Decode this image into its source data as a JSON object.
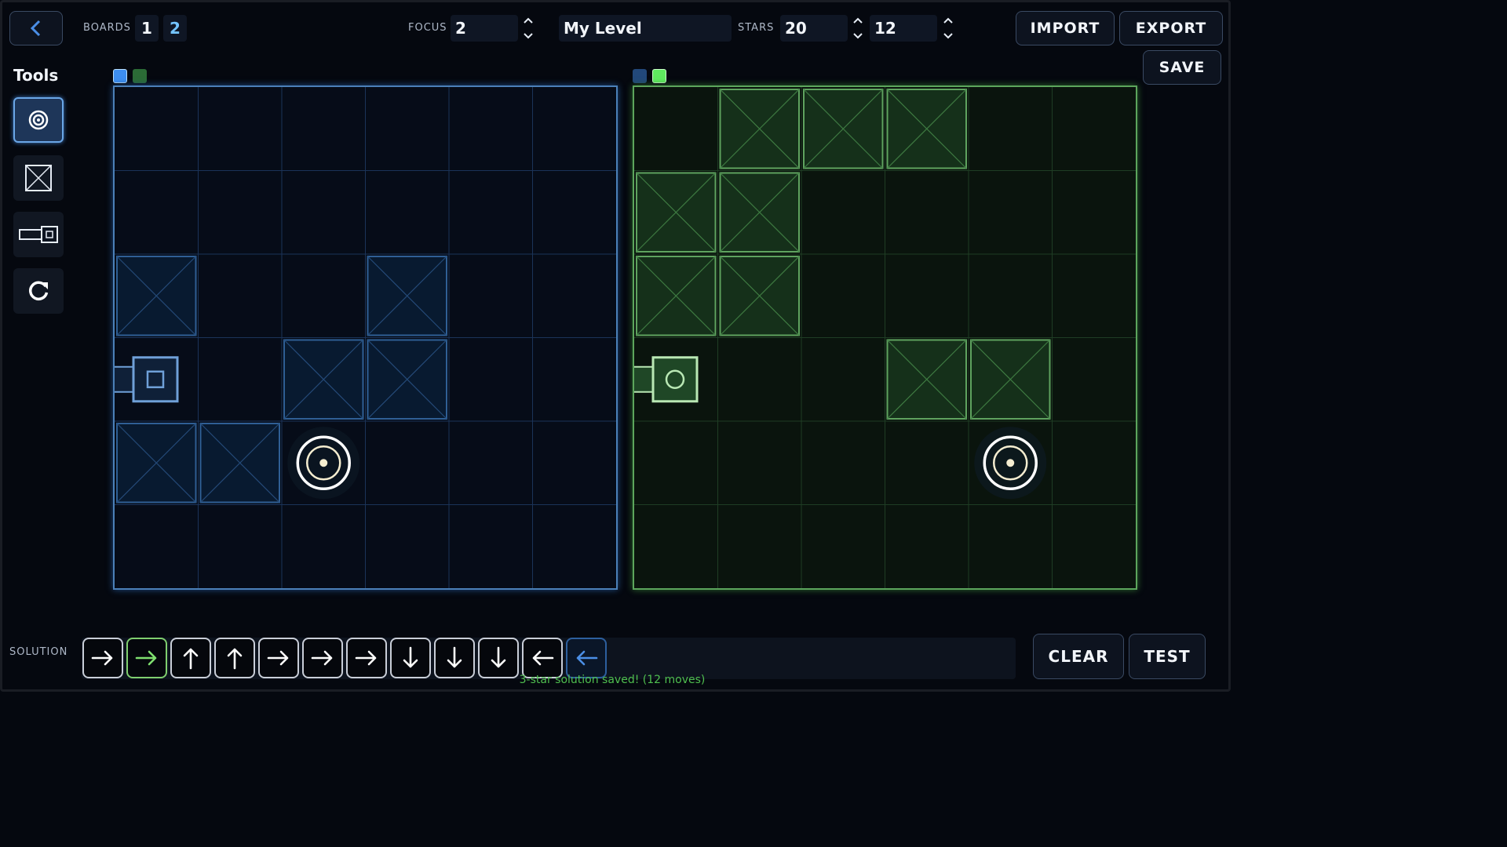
{
  "header": {
    "boards_label": "BOARDS",
    "board_1": "1",
    "board_2": "2",
    "focus_label": "FOCUS",
    "focus_value": "2",
    "level_name": "My Level",
    "stars_label": "STARS",
    "stars_value_1": "20",
    "stars_value_2": "12",
    "import_label": "IMPORT",
    "export_label": "EXPORT",
    "save_label": "SAVE"
  },
  "tools": {
    "title": "Tools",
    "items": [
      {
        "name": "target-tool",
        "icon": "target-icon",
        "selected": true
      },
      {
        "name": "block-tool",
        "icon": "crate-icon",
        "selected": false
      },
      {
        "name": "player-tool",
        "icon": "player-icon",
        "selected": false
      },
      {
        "name": "rotate-tool",
        "icon": "rotate-icon",
        "selected": false
      }
    ]
  },
  "boards": [
    {
      "name": "board-1",
      "theme": "blue",
      "color": "#4b80b8",
      "swatches": [
        "#3d8ef0",
        "#2b6b36"
      ],
      "grid_size": 6,
      "blocks": [
        [
          0,
          2
        ],
        [
          3,
          2
        ],
        [
          2,
          3
        ],
        [
          3,
          3
        ],
        [
          0,
          4
        ],
        [
          1,
          4
        ]
      ],
      "player": {
        "col": 0,
        "row": 3,
        "shape": "square"
      },
      "target": {
        "col": 2,
        "row": 4
      }
    },
    {
      "name": "board-2",
      "theme": "green",
      "color": "#5ca55c",
      "swatches": [
        "#22487a",
        "#5fea5f"
      ],
      "grid_size": 6,
      "blocks": [
        [
          1,
          0
        ],
        [
          2,
          0
        ],
        [
          3,
          0
        ],
        [
          0,
          1
        ],
        [
          1,
          1
        ],
        [
          0,
          2
        ],
        [
          1,
          2
        ],
        [
          3,
          3
        ],
        [
          4,
          3
        ]
      ],
      "player": {
        "col": 0,
        "row": 3,
        "shape": "circle"
      },
      "target": {
        "col": 4,
        "row": 4
      }
    }
  ],
  "solution": {
    "label": "SOLUTION",
    "moves": [
      {
        "dir": "right",
        "style": "white"
      },
      {
        "dir": "right",
        "style": "green"
      },
      {
        "dir": "up",
        "style": "white"
      },
      {
        "dir": "up",
        "style": "white"
      },
      {
        "dir": "right",
        "style": "white"
      },
      {
        "dir": "right",
        "style": "white"
      },
      {
        "dir": "right",
        "style": "white"
      },
      {
        "dir": "down",
        "style": "white"
      },
      {
        "dir": "down",
        "style": "white"
      },
      {
        "dir": "down",
        "style": "white"
      },
      {
        "dir": "left",
        "style": "white"
      },
      {
        "dir": "left",
        "style": "blue"
      }
    ],
    "clear_label": "CLEAR",
    "test_label": "TEST",
    "status": "3-star solution saved! (12 moves)"
  }
}
